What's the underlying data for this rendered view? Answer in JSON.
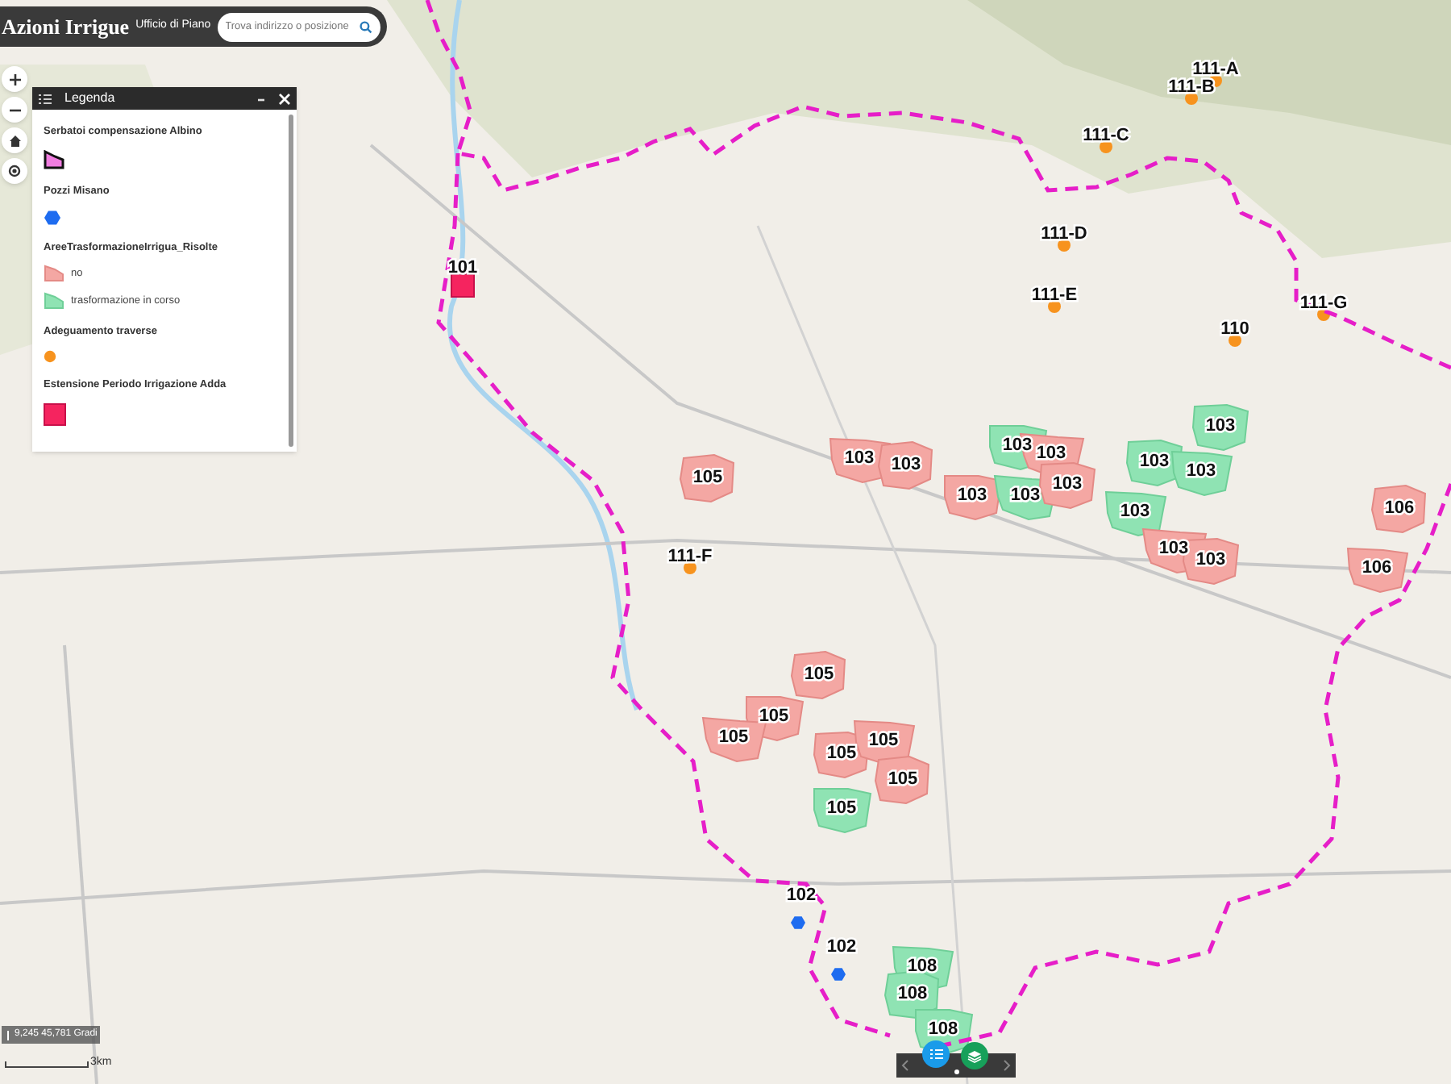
{
  "header": {
    "title": "Azioni Irrigue",
    "subtitle": "Ufficio di Piano",
    "search": {
      "placeholder": "Trova indirizzo o posizione"
    }
  },
  "legend": {
    "title": "Legenda",
    "sections": [
      {
        "title": "Serbatoi compensazione Albino",
        "symbols": [
          {
            "kind": "reservoir"
          }
        ]
      },
      {
        "title": "Pozzi Misano",
        "symbols": [
          {
            "kind": "well"
          }
        ]
      },
      {
        "title": "AreeTrasformazioneIrrigua_Risolte",
        "symbols": [
          {
            "kind": "area_no",
            "label": "no"
          },
          {
            "kind": "area_corso",
            "label": "trasformazione in corso"
          }
        ]
      },
      {
        "title": "Adeguamento traverse",
        "symbols": [
          {
            "kind": "weir"
          }
        ]
      },
      {
        "title": "Estensione Periodo Irrigazione Adda",
        "symbols": [
          {
            "kind": "extension"
          }
        ]
      }
    ]
  },
  "features": [
    {
      "label": "111-A",
      "kind": "weir"
    },
    {
      "label": "111-B",
      "kind": "weir"
    },
    {
      "label": "111-C",
      "kind": "weir"
    },
    {
      "label": "111-D",
      "kind": "weir"
    },
    {
      "label": "101",
      "kind": "extension"
    },
    {
      "label": "111-E",
      "kind": "weir"
    },
    {
      "label": "111-G",
      "kind": "weir"
    },
    {
      "label": "110",
      "kind": "weir"
    },
    {
      "label": "103",
      "kind": "area",
      "transforming": true
    },
    {
      "label": "103",
      "kind": "area",
      "transforming": false
    },
    {
      "label": "103",
      "kind": "area",
      "transforming": false
    },
    {
      "label": "103",
      "kind": "area",
      "transforming": true
    },
    {
      "label": "103",
      "kind": "area",
      "transforming": false
    },
    {
      "label": "103",
      "kind": "area",
      "transforming": true
    },
    {
      "label": "103",
      "kind": "area",
      "transforming": true
    },
    {
      "label": "105",
      "kind": "area",
      "transforming": false
    },
    {
      "label": "103",
      "kind": "area",
      "transforming": false
    },
    {
      "label": "103",
      "kind": "area",
      "transforming": true
    },
    {
      "label": "103",
      "kind": "area",
      "transforming": false
    },
    {
      "label": "103",
      "kind": "area",
      "transforming": true
    },
    {
      "label": "106",
      "kind": "area",
      "transforming": false
    },
    {
      "label": "111-F",
      "kind": "weir"
    },
    {
      "label": "103",
      "kind": "area",
      "transforming": false
    },
    {
      "label": "103",
      "kind": "area",
      "transforming": false
    },
    {
      "label": "106",
      "kind": "area",
      "transforming": false
    },
    {
      "label": "105",
      "kind": "area",
      "transforming": false
    },
    {
      "label": "105",
      "kind": "area",
      "transforming": false
    },
    {
      "label": "105",
      "kind": "area",
      "transforming": false
    },
    {
      "label": "105",
      "kind": "area",
      "transforming": false
    },
    {
      "label": "105",
      "kind": "area",
      "transforming": false
    },
    {
      "label": "105",
      "kind": "area",
      "transforming": false
    },
    {
      "label": "105",
      "kind": "area",
      "transforming": true
    },
    {
      "label": "102",
      "kind": "well"
    },
    {
      "label": "102",
      "kind": "well"
    },
    {
      "label": "108",
      "kind": "area",
      "transforming": true
    },
    {
      "label": "108",
      "kind": "area",
      "transforming": true
    },
    {
      "label": "108",
      "kind": "area",
      "transforming": true
    }
  ],
  "coordinates": "9,245 45,781 Gradi",
  "scale": "3km"
}
